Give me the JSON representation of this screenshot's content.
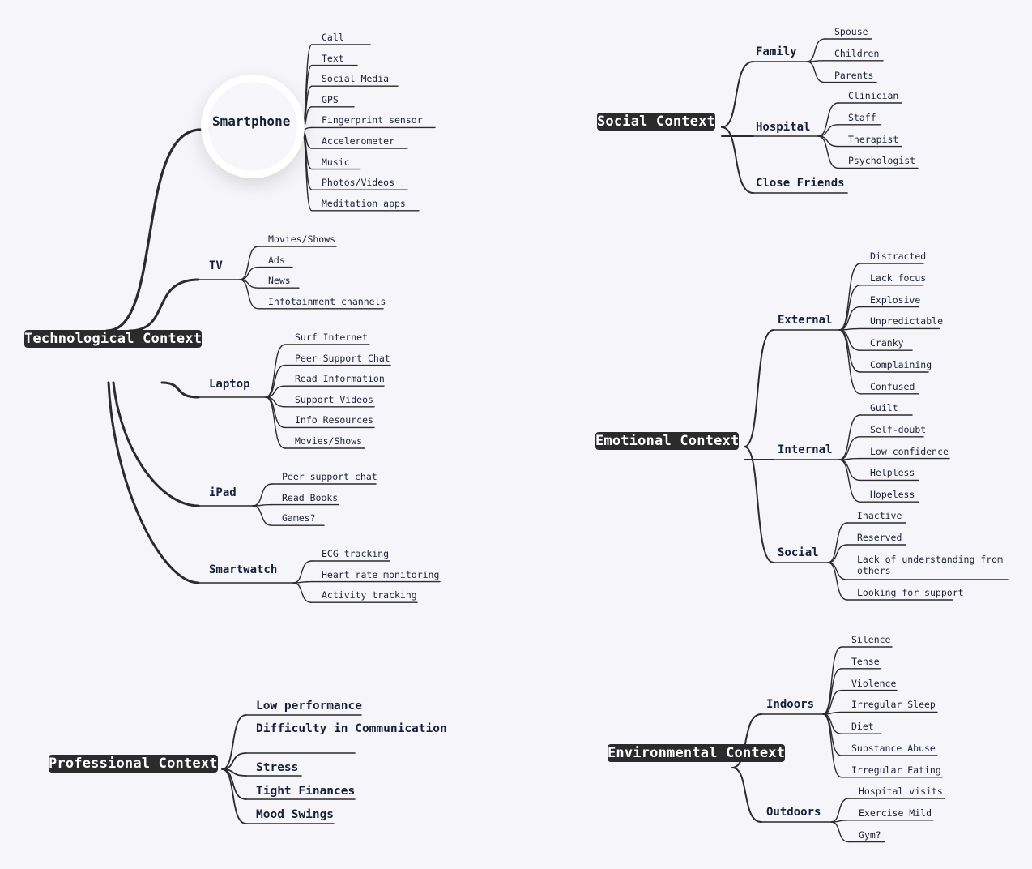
{
  "roots": {
    "technological": {
      "label": "Technological Context",
      "branches": [
        {
          "label": "Smartphone",
          "children": [
            "Call",
            "Text",
            "Social Media",
            "GPS",
            "Fingerprint sensor",
            "Accelerometer",
            "Music",
            "Photos/Videos",
            "Meditation apps"
          ]
        },
        {
          "label": "TV",
          "children": [
            "Movies/Shows",
            "Ads",
            "News",
            "Infotainment channels"
          ]
        },
        {
          "label": "Laptop",
          "children": [
            "Surf Internet",
            "Peer Support Chat",
            "Read Information",
            "Support Videos",
            "Info Resources",
            "Movies/Shows"
          ]
        },
        {
          "label": "iPad",
          "children": [
            "Peer support chat",
            "Read Books",
            "Games?"
          ]
        },
        {
          "label": "Smartwatch",
          "children": [
            "ECG tracking",
            "Heart rate monitoring",
            "Activity tracking"
          ]
        }
      ]
    },
    "professional": {
      "label": "Professional Context",
      "branches": [
        "Low performance",
        "Difficulty in Communication",
        "Stress",
        "Tight Finances",
        "Mood Swings"
      ]
    },
    "social": {
      "label": "Social Context",
      "branches": [
        {
          "label": "Family",
          "children": [
            "Spouse",
            "Children",
            "Parents"
          ]
        },
        {
          "label": "Hospital",
          "children": [
            "Clinician",
            "Staff",
            "Therapist",
            "Psychologist"
          ]
        },
        {
          "label": "Close Friends",
          "children": []
        }
      ]
    },
    "emotional": {
      "label": "Emotional Context",
      "branches": [
        {
          "label": "External",
          "children": [
            "Distracted",
            "Lack focus",
            "Explosive",
            "Unpredictable",
            "Cranky",
            "Complaining",
            "Confused"
          ]
        },
        {
          "label": "Internal",
          "children": [
            "Guilt",
            "Self-doubt",
            "Low confidence",
            "Helpless",
            "Hopeless"
          ]
        },
        {
          "label": "Social",
          "children": [
            "Inactive",
            "Reserved",
            "Lack of understanding from others",
            "Looking for support"
          ]
        }
      ]
    },
    "environmental": {
      "label": "Environmental Context",
      "branches": [
        {
          "label": "Indoors",
          "children": [
            "Silence",
            "Tense",
            "Violence",
            "Irregular Sleep",
            "Diet",
            "Substance Abuse",
            "Irregular Eating"
          ]
        },
        {
          "label": "Outdoors",
          "children": [
            "Hospital visits",
            "Exercise Mild",
            "Gym?"
          ]
        }
      ]
    }
  },
  "colors": {
    "background": "#f5f5fa",
    "root_fill": "#2b2b2b",
    "line": "#2b2b2b",
    "text": "#142038"
  }
}
